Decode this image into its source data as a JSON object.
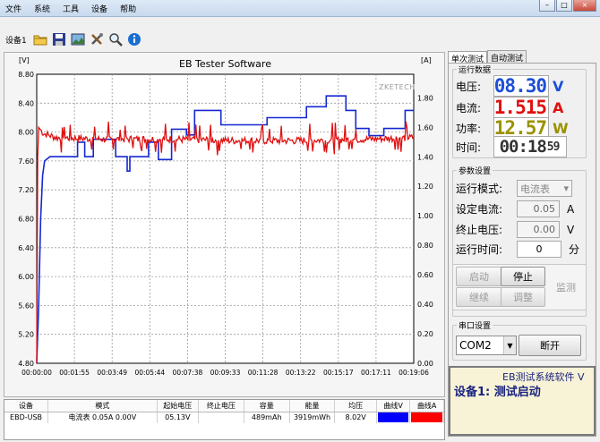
{
  "menu": [
    "文件",
    "系统",
    "工具",
    "设备",
    "帮助"
  ],
  "window_controls": [
    "–",
    "□",
    "×"
  ],
  "toolbar": {
    "device_label": "设备1",
    "icons": [
      "folder-open-icon",
      "save-icon",
      "chart-image-icon",
      "tools-icon",
      "magnifier-icon",
      "info-icon"
    ]
  },
  "chart": {
    "unit_left": "[V]",
    "unit_right": "[A]",
    "watermark": "ZKETECH"
  },
  "chart_data": {
    "type": "line",
    "title": "EB Tester Software",
    "y_left_ticks": [
      "8.80",
      "8.40",
      "8.00",
      "7.60",
      "7.20",
      "6.80",
      "6.40",
      "6.00",
      "5.60",
      "5.20",
      "4.80"
    ],
    "y_right_ticks": [
      "1.80",
      "1.60",
      "1.40",
      "1.20",
      "1.00",
      "0.80",
      "0.60",
      "0.40",
      "0.20",
      "0.00"
    ],
    "x_ticks": [
      "00:00:00",
      "00:01:55",
      "00:03:49",
      "00:05:44",
      "00:07:38",
      "00:09:33",
      "00:11:28",
      "00:13:22",
      "00:15:17",
      "00:17:11",
      "00:19:06"
    ],
    "ylim_left": [
      4.8,
      8.8
    ],
    "ylim_right": [
      0.0,
      1.96
    ],
    "xlim_seconds": [
      0,
      1146
    ],
    "grid": true,
    "series": [
      {
        "axis": "left",
        "color": "#1428d2",
        "points": [
          [
            0,
            4.8
          ],
          [
            6,
            5.6
          ],
          [
            12,
            6.8
          ],
          [
            18,
            7.4
          ],
          [
            24,
            7.6
          ],
          [
            40,
            7.66
          ],
          [
            124,
            7.66
          ],
          [
            124,
            7.86
          ],
          [
            146,
            7.86
          ],
          [
            146,
            7.66
          ],
          [
            172,
            7.66
          ],
          [
            172,
            7.9
          ],
          [
            240,
            7.9
          ],
          [
            240,
            7.66
          ],
          [
            275,
            7.66
          ],
          [
            275,
            7.46
          ],
          [
            283,
            7.46
          ],
          [
            283,
            7.66
          ],
          [
            340,
            7.66
          ],
          [
            340,
            7.86
          ],
          [
            370,
            7.86
          ],
          [
            370,
            7.62
          ],
          [
            410,
            7.62
          ],
          [
            410,
            8.04
          ],
          [
            455,
            8.04
          ],
          [
            455,
            7.96
          ],
          [
            480,
            7.96
          ],
          [
            480,
            8.3
          ],
          [
            560,
            8.3
          ],
          [
            560,
            8.1
          ],
          [
            700,
            8.1
          ],
          [
            700,
            8.2
          ],
          [
            820,
            8.2
          ],
          [
            820,
            8.35
          ],
          [
            880,
            8.35
          ],
          [
            880,
            8.5
          ],
          [
            940,
            8.5
          ],
          [
            940,
            8.3
          ],
          [
            970,
            8.3
          ],
          [
            970,
            8.05
          ],
          [
            1010,
            8.05
          ],
          [
            1010,
            7.95
          ],
          [
            1055,
            7.95
          ],
          [
            1055,
            8.05
          ],
          [
            1120,
            8.05
          ],
          [
            1120,
            8.3
          ],
          [
            1146,
            8.3
          ]
        ]
      },
      {
        "axis": "right",
        "color": "#e01010",
        "noisy": true,
        "base": 1.52,
        "points": [
          [
            0,
            0.0
          ],
          [
            3,
            1.4
          ],
          [
            6,
            1.6
          ],
          [
            20,
            1.56
          ],
          [
            60,
            1.53
          ],
          [
            200,
            1.52
          ],
          [
            400,
            1.52
          ],
          [
            600,
            1.51
          ],
          [
            800,
            1.51
          ],
          [
            1000,
            1.52
          ],
          [
            1146,
            1.53
          ]
        ]
      }
    ]
  },
  "table": {
    "headers": [
      "设备",
      "模式",
      "起始电压",
      "终止电压",
      "容量",
      "能量",
      "均压",
      "曲线V",
      "曲线A"
    ],
    "row": [
      "EBD-USB",
      "电流表  0.05A  0.00V",
      "05.13V",
      "",
      "489mAh",
      "3919mWh",
      "8.02V",
      "",
      ""
    ],
    "swatch_v": "#0000ff",
    "swatch_a": "#ff0000"
  },
  "tabs": [
    "单次测试",
    "自动测试"
  ],
  "measure": {
    "legend": "运行数据",
    "voltage_label": "电压:",
    "voltage_value": "08.30",
    "voltage_unit": "V",
    "voltage_color": "#1d4fd8",
    "current_label": "电流:",
    "current_value": "1.515",
    "current_unit": "A",
    "current_color": "#e01010",
    "power_label": "功率:",
    "power_value": "12.57",
    "power_unit": "W",
    "power_color": "#9a9200",
    "time_label": "时间:",
    "time_value": "00:18",
    "time_seconds": "59"
  },
  "params": {
    "legend": "参数设置",
    "mode_label": "运行模式:",
    "mode_value": "电流表",
    "set_current_label": "设定电流:",
    "set_current_value": "0.05",
    "set_current_unit": "A",
    "end_voltage_label": "终止电压:",
    "end_voltage_value": "0.00",
    "end_voltage_unit": "V",
    "run_time_label": "运行时间:",
    "run_time_value": "0",
    "run_time_unit": "分"
  },
  "buttons": {
    "start": "启动",
    "stop": "停止",
    "continue": "继续",
    "adjust": "调整",
    "monitor": "监测"
  },
  "serial": {
    "legend": "串口设置",
    "port": "COM2",
    "disconnect": "断开"
  },
  "status": {
    "marquee": "EB测试系统软件 V",
    "message": "设备1: 测试启动"
  }
}
